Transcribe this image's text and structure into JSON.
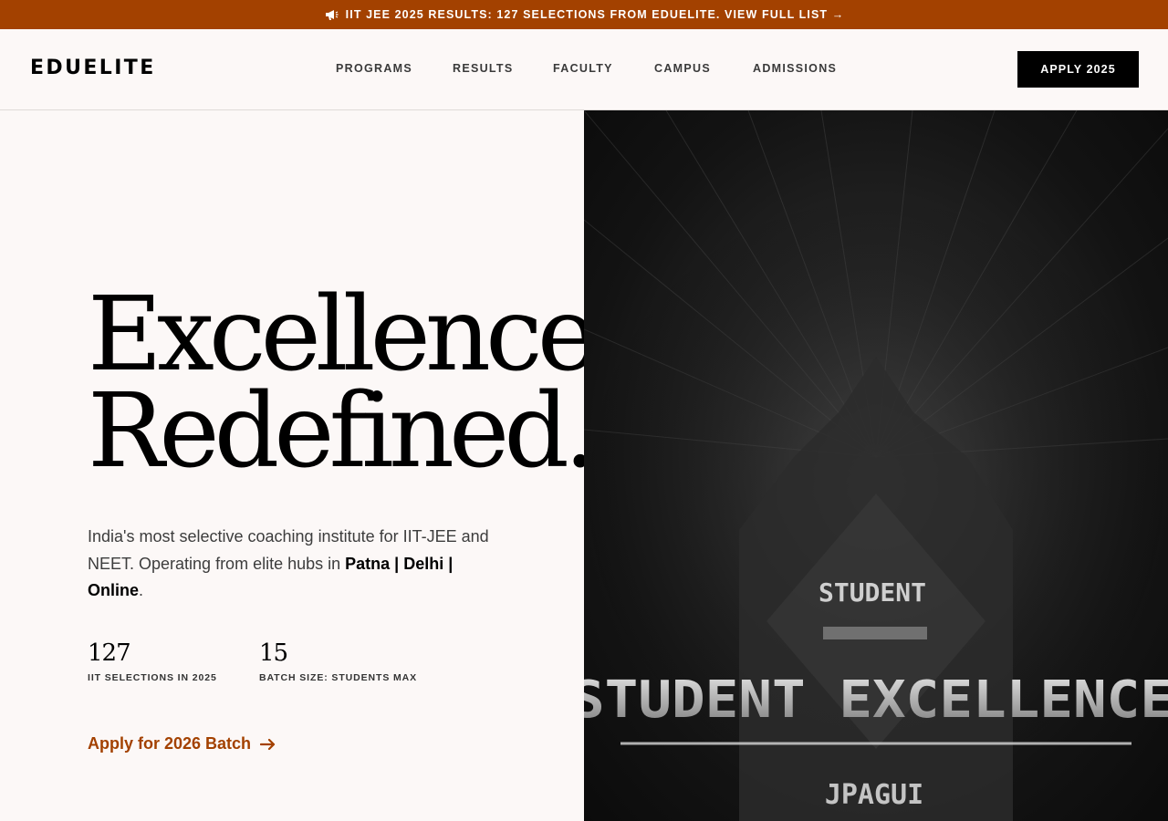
{
  "announcement": {
    "text": "IIT JEE 2025 RESULTS: 127 SELECTIONS FROM EDUELITE. VIEW FULL LIST →"
  },
  "brand": {
    "logo": "EDUELITE"
  },
  "nav": {
    "items": [
      {
        "label": "PROGRAMS"
      },
      {
        "label": "RESULTS"
      },
      {
        "label": "FACULTY"
      },
      {
        "label": "CAMPUS"
      },
      {
        "label": "ADMISSIONS"
      }
    ],
    "cta_label": "APPLY 2025"
  },
  "hero": {
    "headline_line1": "Excellence.",
    "headline_line2": "Redefined.",
    "intro_text": "India's most selective coaching institute for IIT-JEE and NEET. Operating from elite hubs in ",
    "intro_hubs": "Patna | Delhi | Online",
    "intro_end": ".",
    "stats": [
      {
        "value": "127",
        "label": "IIT SELECTIONS IN 2025"
      },
      {
        "value": "15",
        "label": "BATCH SIZE: STUDENTS MAX"
      }
    ],
    "cta_label": "Apply for 2026 Batch"
  },
  "image": {
    "text_top": "STUDENT",
    "text_main": "STUDENT EXCELLENCE",
    "text_bottom": "JPAGUI"
  },
  "colors": {
    "accent": "#a34100",
    "background": "#fcf8f7",
    "black": "#000000"
  }
}
